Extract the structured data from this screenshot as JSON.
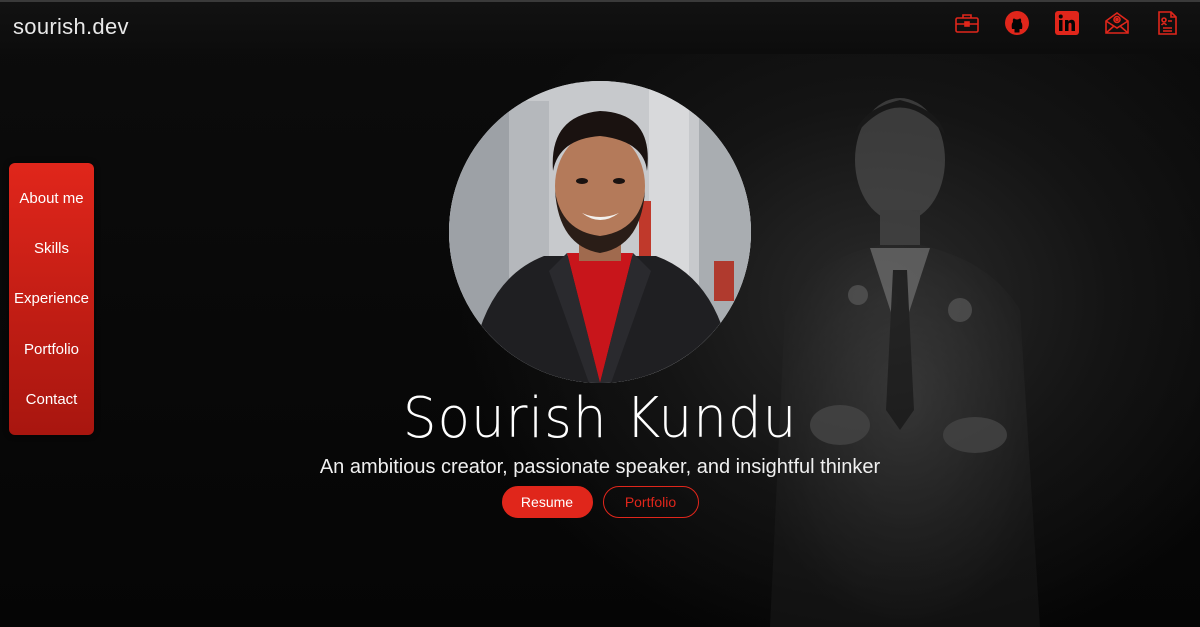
{
  "header": {
    "brand": "sourish.dev",
    "icons": [
      "briefcase-icon",
      "github-icon",
      "linkedin-icon",
      "mail-icon",
      "resume-icon"
    ]
  },
  "sidebar": {
    "items": [
      {
        "label": "About me"
      },
      {
        "label": "Skills"
      },
      {
        "label": "Experience"
      },
      {
        "label": "Portfolio"
      },
      {
        "label": "Contact"
      }
    ]
  },
  "hero": {
    "name": "Sourish Kundu",
    "tagline": "An ambitious creator, passionate speaker, and insightful thinker",
    "primary_button": "Resume",
    "secondary_button": "Portfolio"
  },
  "colors": {
    "accent": "#e0261b",
    "background": "#050505"
  }
}
